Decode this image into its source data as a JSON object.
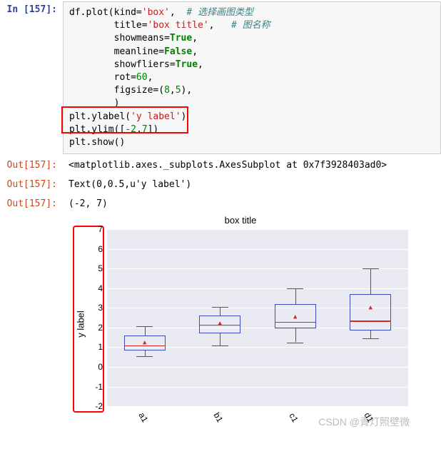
{
  "cells": {
    "in_prompt": "In [157]:",
    "out_prompt": "Out[157]:",
    "code": {
      "l1a": "df.plot(kind=",
      "l1s": "'box'",
      "l1b": ",  ",
      "l1c": "# 选择画图类型",
      "l2a": "        title=",
      "l2s": "'box title'",
      "l2b": ",   ",
      "l2c": "# 图名称",
      "l3a": "        showmeans=",
      "l3k": "True",
      "l3b": ",",
      "l4a": "        meanline=",
      "l4k": "False",
      "l4b": ",",
      "l5a": "        showfliers=",
      "l5k": "True",
      "l5b": ",",
      "l6a": "        rot=",
      "l6n": "60",
      "l6b": ",",
      "l7a": "        figsize=(",
      "l7n1": "8",
      "l7c": ",",
      "l7n2": "5",
      "l7b": "),",
      "l8a": "        )",
      "l9a": "plt.ylabel(",
      "l9s": "'y label'",
      "l9b": ")",
      "l10a": "plt.ylim([",
      "l10n1": "-2",
      "l10c": ",",
      "l10n2": "7",
      "l10b": "])",
      "l11a": "plt.show()"
    },
    "out1": "<matplotlib.axes._subplots.AxesSubplot at 0x7f3928403ad0>",
    "out2": "Text(0,0.5,u'y label')",
    "out3": "(-2, 7)"
  },
  "chart_data": {
    "type": "box",
    "title": "box title",
    "xlabel": "",
    "ylabel": "y label",
    "ylim": [
      -2,
      7
    ],
    "yticks": [
      -2,
      -1,
      0,
      1,
      2,
      3,
      4,
      5,
      6,
      7
    ],
    "categories": [
      "a1",
      "b1",
      "c1",
      "d1"
    ],
    "series": [
      {
        "name": "a1",
        "q1": 0.85,
        "median": 1.1,
        "q3": 1.6,
        "lo": 0.55,
        "hi": 2.05,
        "mean": 1.25
      },
      {
        "name": "b1",
        "q1": 1.7,
        "median": 2.15,
        "q3": 2.6,
        "lo": 1.1,
        "hi": 3.05,
        "mean": 2.2
      },
      {
        "name": "c1",
        "q1": 1.95,
        "median": 2.3,
        "q3": 3.2,
        "lo": 1.25,
        "hi": 4.0,
        "mean": 2.55
      },
      {
        "name": "d1",
        "q1": 1.85,
        "median": 2.35,
        "q3": 3.7,
        "lo": 1.45,
        "hi": 5.0,
        "mean": 3.0
      }
    ]
  },
  "watermark": "CSDN @青灯照壁微"
}
